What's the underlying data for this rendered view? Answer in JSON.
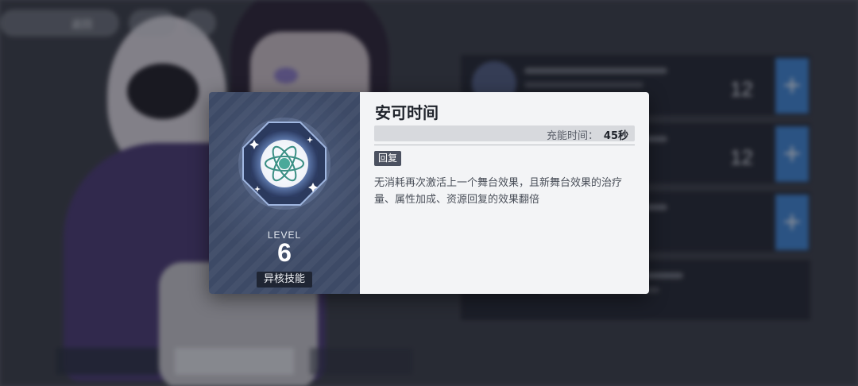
{
  "background": {
    "top_left_button_label": "返回",
    "rows": [
      {
        "count": "12"
      },
      {
        "count": "12"
      },
      {
        "count": ""
      }
    ],
    "plus_symbol": "+",
    "colors": {
      "accent_blue": "#3f86d6"
    }
  },
  "skill_card": {
    "emblem_icon": "atom-crystal-icon",
    "level_label": "LEVEL",
    "level_value": "6",
    "skill_type": "异核技能",
    "title": "安可时间",
    "charge_label": "充能时间：",
    "charge_value": "45秒",
    "tag": "回复",
    "description": "无消耗再次激活上一个舞台效果，且新舞台效果的治疗量、属性加成、资源回复的效果翻倍"
  }
}
